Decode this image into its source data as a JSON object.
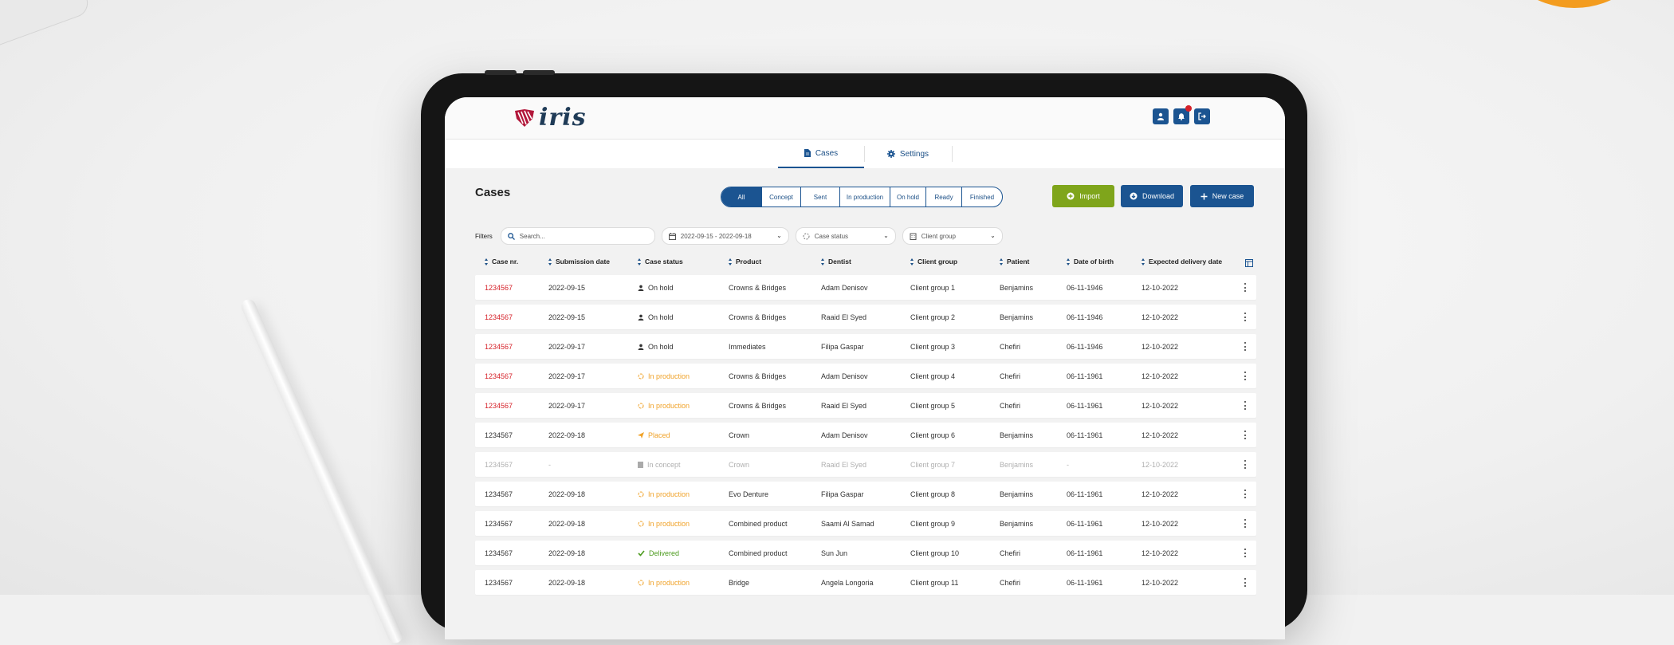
{
  "app": {
    "logo_text": "iris"
  },
  "nav": {
    "tabs": [
      {
        "label": "Cases",
        "active": true
      },
      {
        "label": "Settings",
        "active": false
      }
    ]
  },
  "page": {
    "title": "Cases"
  },
  "status_filter": {
    "options": [
      "All",
      "Concept",
      "Sent",
      "In production",
      "On hold",
      "Ready",
      "Finished"
    ],
    "selected": "All"
  },
  "actions": {
    "import": "Import",
    "download": "Download",
    "new_case": "New case"
  },
  "filters": {
    "label": "Filters",
    "search_placeholder": "Search...",
    "date_range": "2022-09-15 - 2022-09-18",
    "case_status": "Case status",
    "client_group": "Client group"
  },
  "table": {
    "columns": [
      "Case nr.",
      "Submission date",
      "Case status",
      "Product",
      "Dentist",
      "Client group",
      "Patient",
      "Date of birth",
      "Expected delivery date"
    ],
    "rows": [
      {
        "case_nr": "1234567",
        "submitted": "2022-09-15",
        "status": "On hold",
        "status_type": "hold",
        "product": "Crowns & Bridges",
        "dentist": "Adam Denisov",
        "client_group": "Client group 1",
        "patient": "Benjamins",
        "dob": "06-11-1946",
        "delivery": "12-10-2022",
        "flag": "red"
      },
      {
        "case_nr": "1234567",
        "submitted": "2022-09-15",
        "status": "On hold",
        "status_type": "hold",
        "product": "Crowns & Bridges",
        "dentist": "Raaid El Syed",
        "client_group": "Client group 2",
        "patient": "Benjamins",
        "dob": "06-11-1946",
        "delivery": "12-10-2022",
        "flag": "red"
      },
      {
        "case_nr": "1234567",
        "submitted": "2022-09-17",
        "status": "On hold",
        "status_type": "hold",
        "product": "Immediates",
        "dentist": "Filipa Gaspar",
        "client_group": "Client group 3",
        "patient": "Chefiri",
        "dob": "06-11-1946",
        "delivery": "12-10-2022",
        "flag": "red"
      },
      {
        "case_nr": "1234567",
        "submitted": "2022-09-17",
        "status": "In production",
        "status_type": "prod",
        "product": "Crowns & Bridges",
        "dentist": "Adam Denisov",
        "client_group": "Client group 4",
        "patient": "Chefiri",
        "dob": "06-11-1961",
        "delivery": "12-10-2022",
        "flag": "red"
      },
      {
        "case_nr": "1234567",
        "submitted": "2022-09-17",
        "status": "In production",
        "status_type": "prod",
        "product": "Crowns & Bridges",
        "dentist": "Raaid El Syed",
        "client_group": "Client group 5",
        "patient": "Chefiri",
        "dob": "06-11-1961",
        "delivery": "12-10-2022",
        "flag": "red"
      },
      {
        "case_nr": "1234567",
        "submitted": "2022-09-18",
        "status": "Placed",
        "status_type": "placed",
        "product": "Crown",
        "dentist": "Adam Denisov",
        "client_group": "Client group 6",
        "patient": "Benjamins",
        "dob": "06-11-1961",
        "delivery": "12-10-2022",
        "flag": "none"
      },
      {
        "case_nr": "1234567",
        "submitted": "-",
        "status": "In concept",
        "status_type": "concept",
        "product": "Crown",
        "dentist": "Raaid El Syed",
        "client_group": "Client group 7",
        "patient": "Benjamins",
        "dob": "-",
        "delivery": "12-10-2022",
        "flag": "dim"
      },
      {
        "case_nr": "1234567",
        "submitted": "2022-09-18",
        "status": "In production",
        "status_type": "prod",
        "product": "Evo Denture",
        "dentist": "Filipa Gaspar",
        "client_group": "Client group 8",
        "patient": "Benjamins",
        "dob": "06-11-1961",
        "delivery": "12-10-2022",
        "flag": "none"
      },
      {
        "case_nr": "1234567",
        "submitted": "2022-09-18",
        "status": "In production",
        "status_type": "prod",
        "product": "Combined product",
        "dentist": "Saami Al Samad",
        "client_group": "Client group 9",
        "patient": "Benjamins",
        "dob": "06-11-1961",
        "delivery": "12-10-2022",
        "flag": "none"
      },
      {
        "case_nr": "1234567",
        "submitted": "2022-09-18",
        "status": "Delivered",
        "status_type": "deliv",
        "product": "Combined product",
        "dentist": "Sun Jun",
        "client_group": "Client group 10",
        "patient": "Chefiri",
        "dob": "06-11-1961",
        "delivery": "12-10-2022",
        "flag": "none"
      },
      {
        "case_nr": "1234567",
        "submitted": "2022-09-18",
        "status": "In production",
        "status_type": "prod",
        "product": "Bridge",
        "dentist": "Angela Longoria",
        "client_group": "Client group 11",
        "patient": "Chefiri",
        "dob": "06-11-1961",
        "delivery": "12-10-2022",
        "flag": "none"
      }
    ]
  },
  "colors": {
    "primary": "#1b5491",
    "import_green": "#7fa51b",
    "alert_red": "#d6222a",
    "in_production": "#f0a228",
    "delivered": "#4c9b1e"
  },
  "icons": [
    "user-icon",
    "bell-icon",
    "logout-icon",
    "document-icon",
    "gear-icon",
    "plus-circle-icon",
    "download-icon",
    "plus-icon",
    "search-icon",
    "calendar-icon",
    "spinner-icon",
    "building-icon",
    "columns-icon",
    "kebab-icon"
  ]
}
